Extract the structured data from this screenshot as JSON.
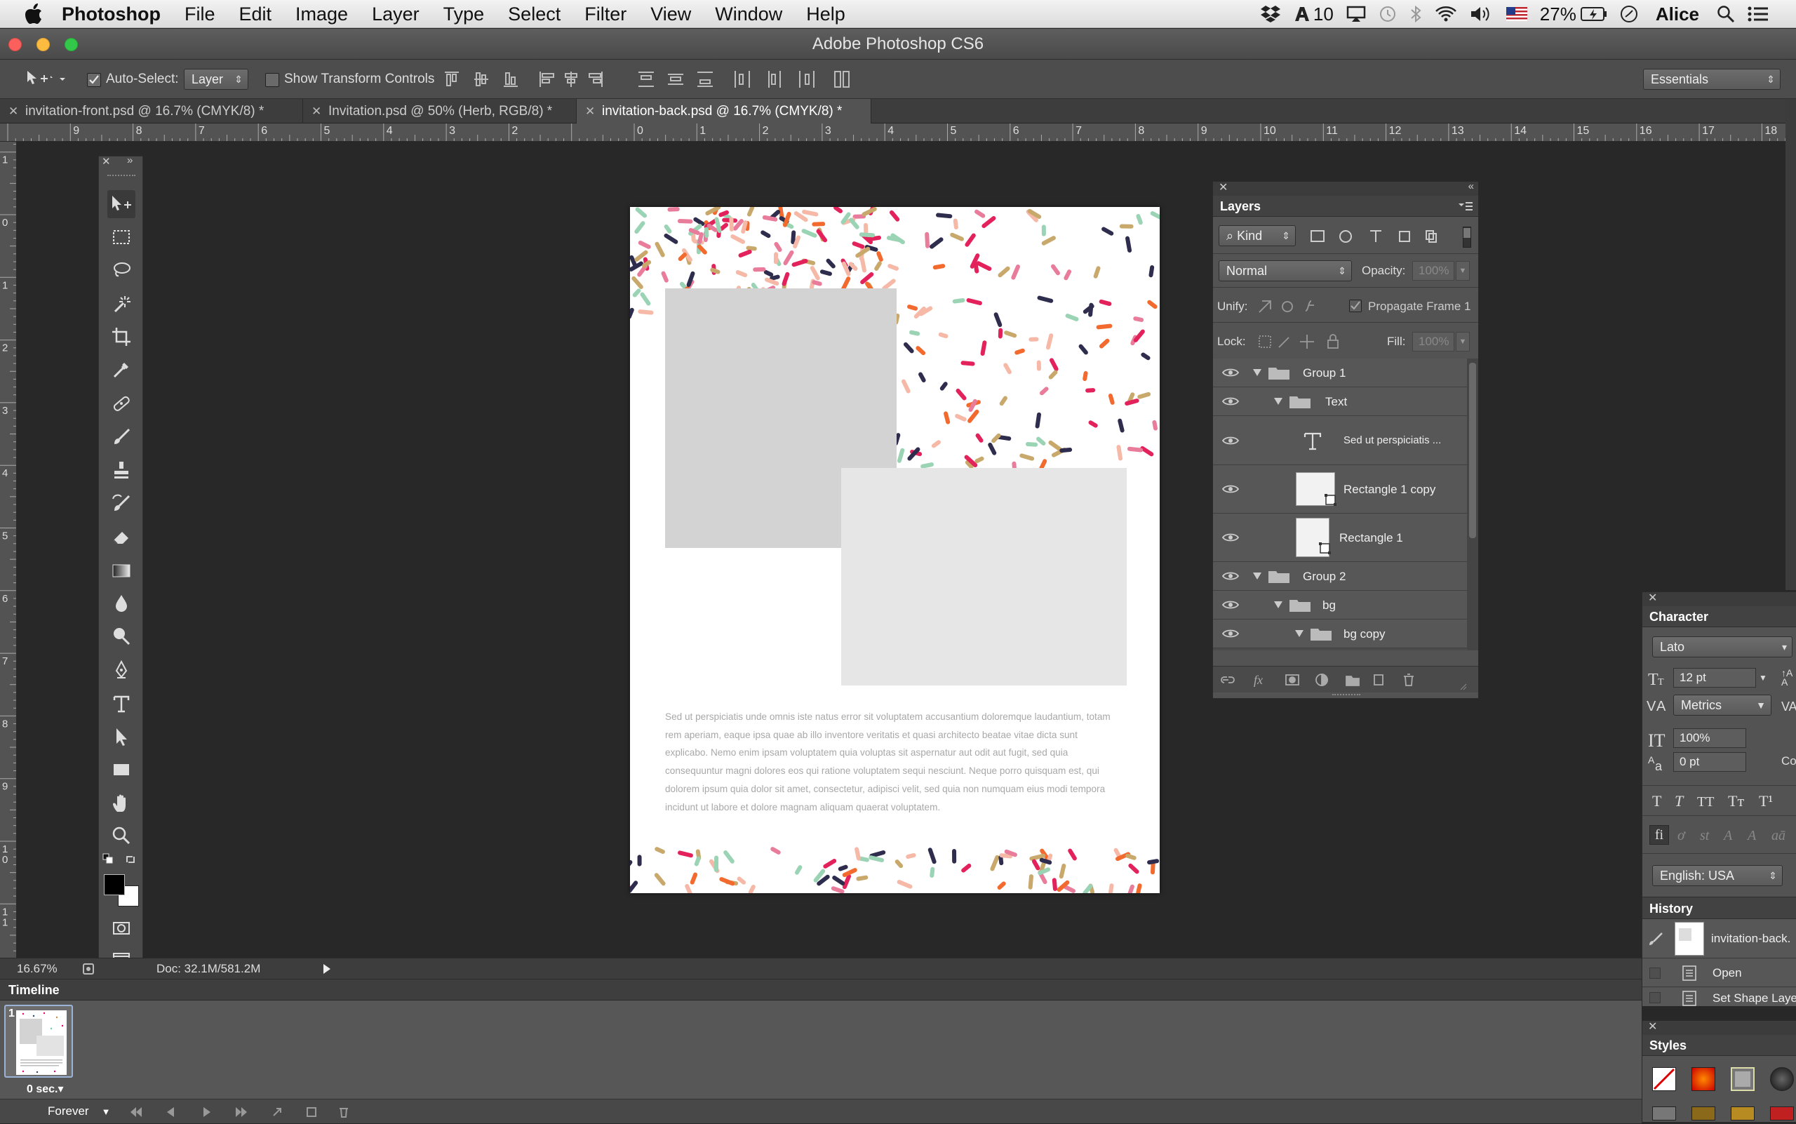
{
  "menubar": {
    "app": "Photoshop",
    "items": [
      "File",
      "Edit",
      "Image",
      "Layer",
      "Type",
      "Select",
      "Filter",
      "View",
      "Window",
      "Help"
    ],
    "status_ten": "10",
    "battery": "27%",
    "user": "Alice"
  },
  "window": {
    "title": "Adobe Photoshop CS6"
  },
  "options": {
    "auto_select_label": "Auto-Select:",
    "auto_select_value": "Layer",
    "transform_label": "Show Transform Controls",
    "workspace": "Essentials"
  },
  "tabs": [
    {
      "label": "invitation-front.psd @ 16.7% (CMYK/8) *"
    },
    {
      "label": "Invitation.psd @ 50% (Herb, RGB/8) *"
    },
    {
      "label": "invitation-back.psd @ 16.7% (CMYK/8) *"
    }
  ],
  "ruler_top": [
    "9",
    "8",
    "7",
    "6",
    "5",
    "4",
    "3",
    "2",
    "0",
    "1",
    "2",
    "3",
    "4",
    "5",
    "6",
    "7",
    "8",
    "9",
    "10",
    "11",
    "12",
    "13",
    "14",
    "15",
    "16",
    "17",
    "18"
  ],
  "ruler_left": [
    "1",
    "0",
    "1",
    "2",
    "3",
    "4",
    "5",
    "6",
    "7",
    "8",
    "9",
    "1 0",
    "1 1"
  ],
  "canvas": {
    "paragraph": "Sed ut perspiciatis unde omnis iste natus error sit voluptatem accusantium doloremque laudantium, totam rem aperiam, eaque ipsa quae ab illo inventore veritatis et quasi architecto beatae vitae dicta sunt explicabo. Nemo enim ipsam voluptatem quia voluptas sit aspernatur aut odit aut fugit, sed quia consequuntur magni dolores eos qui ratione voluptatem sequi nesciunt. Neque porro quisquam est, qui dolorem ipsum quia dolor sit amet, consectetur, adipisci velit, sed quia non numquam eius modi tempora incidunt ut labore et dolore magnam aliquam quaerat voluptatem."
  },
  "status": {
    "zoom": "16.67%",
    "doc": "Doc: 32.1M/581.2M"
  },
  "timeline": {
    "title": "Timeline",
    "frame_number": "1",
    "frame_delay": "0 sec.",
    "loop": "Forever"
  },
  "layers": {
    "title": "Layers",
    "filter_kind": "Kind",
    "blend": "Normal",
    "opacity_label": "Opacity:",
    "opacity_value": "100%",
    "unify_label": "Unify:",
    "propagate_label": "Propagate Frame 1",
    "lock_label": "Lock:",
    "fill_label": "Fill:",
    "fill_value": "100%",
    "rows": [
      {
        "name": "Group 1",
        "type": "group"
      },
      {
        "name": "Text",
        "type": "group"
      },
      {
        "name": "Sed ut perspiciatis ...",
        "type": "text"
      },
      {
        "name": "Rectangle 1 copy",
        "type": "shape"
      },
      {
        "name": "Rectangle 1",
        "type": "shape"
      },
      {
        "name": "Group 2",
        "type": "group"
      },
      {
        "name": "bg",
        "type": "group"
      },
      {
        "name": "bg copy",
        "type": "group"
      }
    ]
  },
  "character": {
    "title": "Character",
    "font": "Lato",
    "size": "12 pt",
    "kerning": "Metrics",
    "vscale": "100%",
    "baseline": "0 pt",
    "language": "English: USA",
    "cut_label": "Co"
  },
  "history": {
    "title": "History",
    "snapshot": "invitation-back.",
    "items": [
      "Open",
      "Set Shape Laye"
    ]
  },
  "styles": {
    "title": "Styles"
  }
}
